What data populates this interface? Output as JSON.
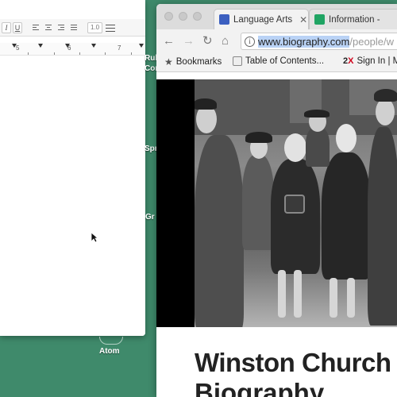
{
  "document_window": {
    "toolbar": {
      "italic_label": "I",
      "underline_label": "U",
      "line_spacing": "1.0"
    },
    "ruler": {
      "marks": [
        "5",
        "6",
        "7"
      ]
    }
  },
  "desktop": {
    "labels": [
      "Rub",
      "Con",
      "Spr",
      "Gr",
      "Atom"
    ]
  },
  "browser": {
    "tabs": [
      {
        "title": "Language Arts",
        "favicon_color": "#3b5fc0"
      },
      {
        "title": "Information - ",
        "favicon_color": "#1fa463"
      }
    ],
    "address_bar": {
      "host": "www.biography.com",
      "path": "/people/w"
    },
    "bookmarks": [
      {
        "label": "Bookmarks",
        "icon": "star-icon"
      },
      {
        "label": "Table of Contents...",
        "icon": "page-favicon"
      },
      {
        "label": "Sign In | M",
        "badge_2": "2",
        "badge_x": "X"
      }
    ],
    "article": {
      "title_line1": "Winston Church",
      "title_line2": "Biography"
    }
  },
  "colors": {
    "desktop": "#3f8a6b",
    "browser_chrome": "#f2f2f2",
    "url_highlight": "#b9d2f5"
  }
}
